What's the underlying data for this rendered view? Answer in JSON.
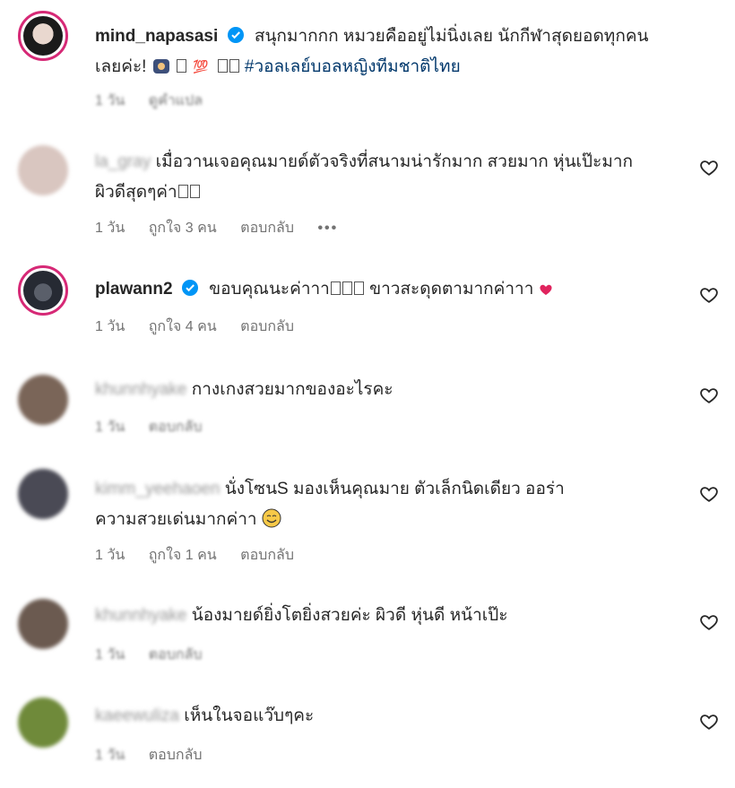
{
  "comments": [
    {
      "username": "mind_napasasi",
      "text": "สนุกมากกก หมวยคืออยู่ไม่นิ่งเลย นักกีฬาสุดยอดทุกคน",
      "text2": "เลยค่ะ! ",
      "hashtag": "#วอลเลย์บอลหญิงทีมชาติไทย",
      "time": "1 วัน",
      "action": "ดูคำแปล"
    },
    {
      "username": "la_gray",
      "text": "เมื่อวานเจอคุณมายด์ตัวจริงที่สนามน่ารักมาก สวยมาก หุ่นเป๊ะมาก",
      "text2": "ผิวดีสุดๆค่า",
      "time": "1 วัน",
      "likes": "ถูกใจ 3 คน",
      "reply": "ตอบกลับ",
      "more": "•••"
    },
    {
      "username": "plawann2",
      "text": "ขอบคุณนะค่าาา",
      "text_after": " ขาวสะดุดตามากค่าาา",
      "time": "1 วัน",
      "likes": "ถูกใจ 4 คน",
      "reply": "ตอบกลับ"
    },
    {
      "username": "khunnhyake",
      "text": " กางเกงสวยมากของอะไรคะ",
      "time": "1 วัน",
      "reply": "ตอบกลับ"
    },
    {
      "username": "kimm_yeehaoen",
      "text": " นั่งโซนS มองเห็นคุณมาย ตัวเล็กนิดเดียว ออร่า",
      "text2": "ความสวยเด่นมากค่าา",
      "time": "1 วัน",
      "likes": "ถูกใจ 1 คน",
      "reply": "ตอบกลับ"
    },
    {
      "username": "khunnhyake",
      "text": " น้องมายด์ยิ่งโตยิ่งสวยค่ะ ผิวดี หุ่นดี หน้าเป๊ะ",
      "time": "1 วัน",
      "reply": "ตอบกลับ"
    },
    {
      "username": "kaeewuliza",
      "text": " เห็นในจอแว๊บๆคะ",
      "time": "1 วัน",
      "reply": "ตอบกลับ"
    }
  ],
  "colors": {
    "link": "#00376b",
    "verified": "#0095f6",
    "meta": "#737373",
    "ring": "#d62976"
  }
}
